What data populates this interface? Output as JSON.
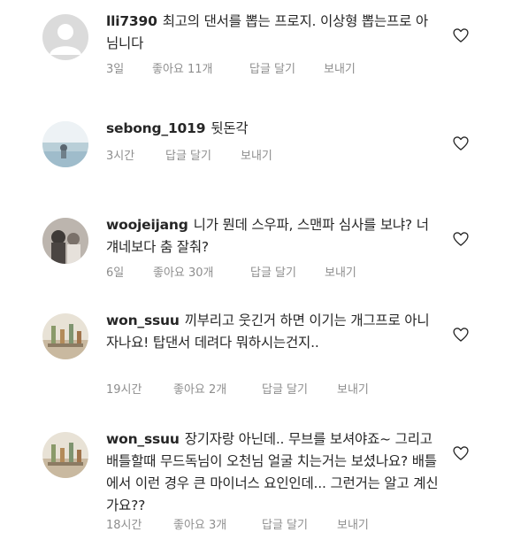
{
  "comments": [
    {
      "username": "lli7390",
      "text": "최고의 댄서를 뽑는 프로지. 이상형 뽑는프로 아님니다",
      "time": "3일",
      "likes": "좋아요 11개",
      "reply": "답글 달기",
      "send": "보내기",
      "avatar": "default-avatar"
    },
    {
      "username": "sebong_1019",
      "text": "뒷돈각",
      "time": "3시간",
      "likes": "",
      "reply": "답글 달기",
      "send": "보내기",
      "avatar": "sea-photo-avatar"
    },
    {
      "username": "woojeijang",
      "text": "니가 뭔데 스우파, 스맨파 심사를 보냐? 너 걔네보다 춤 잘춰?",
      "time": "6일",
      "likes": "좋아요 30개",
      "reply": "답글 달기",
      "send": "보내기",
      "avatar": "people-photo-avatar"
    },
    {
      "username": "won_ssuu",
      "text": "끼부리고 웃긴거 하면 이기는 개그프로 아니자나요! 탑댄서 데려다 뭐하시는건지..",
      "time": "19시간",
      "likes": "좋아요 2개",
      "reply": "답글 달기",
      "send": "보내기",
      "avatar": "cafe-photo-avatar"
    },
    {
      "username": "won_ssuu",
      "text": "장기자랑 아닌데.. 무브를 보셔야죠~ 그리고 배틀할때 무드독님이 오천님 얼굴 치는거는 보셨나요? 배틀에서 이런 경우 큰 마이너스 요인인데... 그런거는 알고 계신가요??",
      "time": "18시간",
      "likes": "좋아요 3개",
      "reply": "답글 달기",
      "send": "보내기",
      "avatar": "cafe-photo-avatar"
    }
  ]
}
